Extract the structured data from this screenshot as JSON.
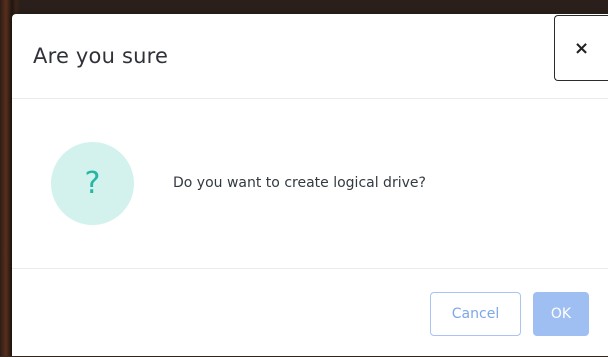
{
  "dialog": {
    "title": "Are you sure",
    "close_label": "×",
    "icon_glyph": "?",
    "icon_name": "question-icon",
    "message": "Do you want to create logical drive?",
    "cancel_label": "Cancel",
    "ok_label": "OK"
  },
  "colors": {
    "icon_background": "#d3f2ed",
    "icon_color": "#27b5a4",
    "primary_button": "#9fbff2",
    "secondary_button_border": "#a9c4f0"
  }
}
